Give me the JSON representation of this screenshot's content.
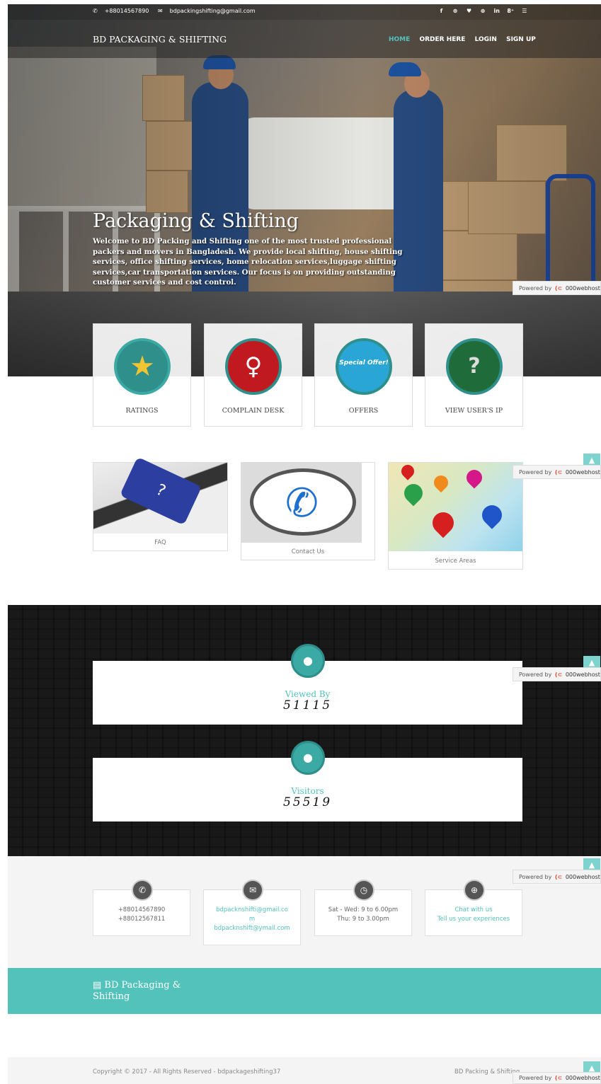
{
  "topbar": {
    "phone": "+88014567890",
    "email": "bdpackingshifting@gmail.com",
    "phone_icon": "phone-icon",
    "email_icon": "envelope-icon",
    "social": [
      "f",
      "⊛",
      "♥",
      "⊕",
      "in",
      "8⁺",
      "☰"
    ]
  },
  "navbar": {
    "brand": "BD PACKAGING & SHIFTING",
    "items": [
      "HOME",
      "ORDER HERE",
      "LOGIN",
      "SIGN UP"
    ],
    "active": "HOME"
  },
  "hero": {
    "title": "Packaging & Shifting",
    "body": "Welcome to BD Packing and Shifting one of the most trusted professional packers and movers in Bangladesh. We provide local shifting, house shifting services, office shifting services, home relocation services,luggage shifting services,car transportation services. Our focus is on providing outstanding customer services and cost control."
  },
  "powered": {
    "prefix": "Powered by",
    "name": "000webhost"
  },
  "features": [
    {
      "label": "RATINGS",
      "icon": "star-icon",
      "glyph": "★"
    },
    {
      "label": "COMPLAIN DESK",
      "icon": "user-icon",
      "glyph": "♀"
    },
    {
      "label": "OFFERS",
      "icon": "special-offer-icon",
      "glyph": "Special Offer!"
    },
    {
      "label": "VIEW USER'S IP",
      "icon": "unknown-user-icon",
      "glyph": "?"
    }
  ],
  "links": [
    {
      "label": "FAQ"
    },
    {
      "label": "Contact Us"
    },
    {
      "label": "Service Areas"
    }
  ],
  "counters": [
    {
      "title": "Viewed By",
      "value": "51115"
    },
    {
      "title": "Visitors",
      "value": "55519"
    }
  ],
  "contact": {
    "phone1": "+88014567890",
    "phone2": "+88012567811",
    "email1": "bdpacknshifti@gmail.co",
    "email1b": "m",
    "email2": "bdpacknshift@ymail.com",
    "hours1": "Sat - Wed: 9 to 6.00pm",
    "hours2": "Thu: 9 to 3.00pm",
    "chat1": "Chat with us",
    "chat2": "Tell us your experiences"
  },
  "footer": {
    "title": "▤ BD Packaging & Shifting",
    "copyright": "Copyright © 2017 - All Rights Reserved - bdpackageshifting37",
    "name": "BD Packing & Shifting"
  },
  "colors": {
    "accent": "#52c2bb",
    "circle": "#2e8f8b",
    "dark": "#101010"
  }
}
